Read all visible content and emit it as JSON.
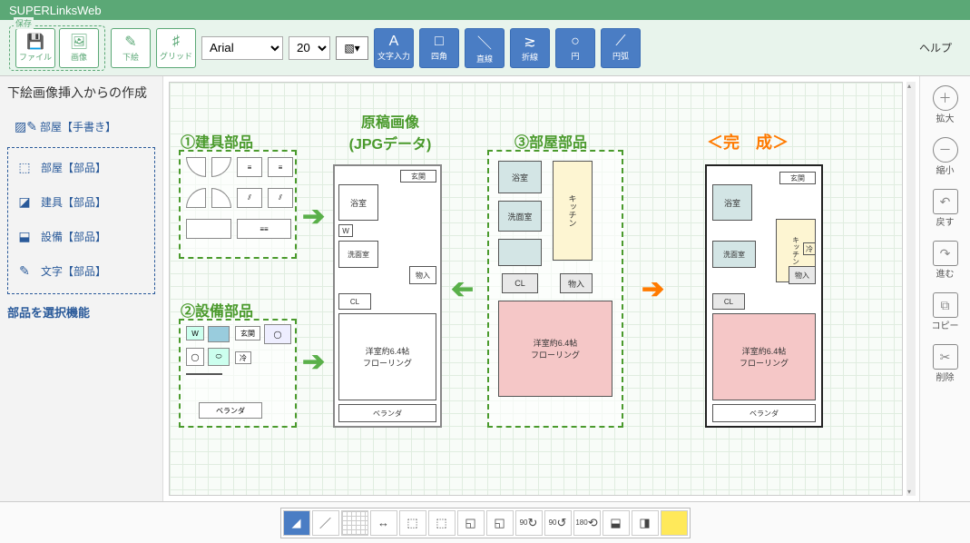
{
  "app": {
    "title": "SUPERLinksWeb"
  },
  "toolbar": {
    "save_group": "保存",
    "file": "ファイル",
    "image": "画像",
    "trace": "下絵",
    "grid": "グリッド",
    "font": "Arial",
    "fontsize": "20",
    "text_input": "文字入力",
    "rect": "四角",
    "line": "直線",
    "polyline": "折線",
    "circle": "円",
    "arc": "円弧",
    "help": "ヘルプ"
  },
  "sidebar": {
    "title": "下絵画像挿入からの作成",
    "items": [
      "部屋【手書き】",
      "部屋【部品】",
      "建具【部品】",
      "設備【部品】",
      "文字【部品】"
    ],
    "footer": "部品を選択機能"
  },
  "rside": {
    "zoom_in": "拡大",
    "zoom_out": "縮小",
    "undo": "戻す",
    "redo": "進む",
    "copy": "コピー",
    "delete": "削除"
  },
  "canvas": {
    "sec1": "①建具部品",
    "sec2": "②設備部品",
    "sec3": "③部屋部品",
    "original_l1": "原稿画像",
    "original_l2": "(JPGデータ)",
    "complete": "＜完　成＞",
    "rooms": {
      "bath": "浴室",
      "washroom": "洗面室",
      "kitchen": "キッチン",
      "entrance": "玄関",
      "storage": "物入",
      "closet": "CL",
      "western_l1": "洋室約6.4帖",
      "western_l2": "フローリング",
      "balcony": "ベランダ",
      "w": "W",
      "fridge": "冷"
    }
  },
  "bottombar": {
    "rotate90a": "90",
    "rotate90b": "90",
    "rotate180": "180"
  }
}
